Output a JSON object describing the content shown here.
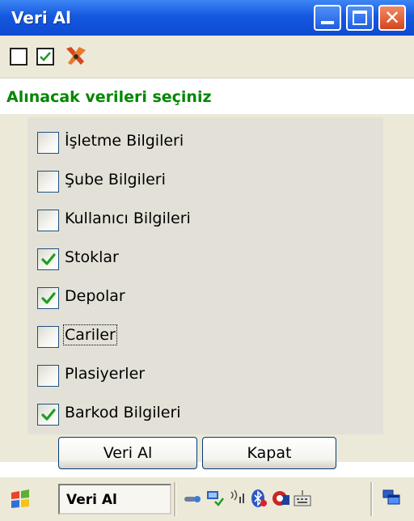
{
  "window": {
    "title": "Veri Al"
  },
  "header": {
    "label": "Alınacak verileri seçiniz"
  },
  "items": [
    {
      "label": "İşletme Bilgileri",
      "checked": false
    },
    {
      "label": "Şube Bilgileri",
      "checked": false
    },
    {
      "label": "Kullanıcı Bilgileri",
      "checked": false
    },
    {
      "label": "Stoklar",
      "checked": true
    },
    {
      "label": "Depolar",
      "checked": true
    },
    {
      "label": "Cariler",
      "checked": false
    },
    {
      "label": "Plasiyerler",
      "checked": false
    },
    {
      "label": "Barkod Bilgileri",
      "checked": true
    }
  ],
  "buttons": {
    "veri_al": "Veri Al",
    "kapat": "Kapat"
  },
  "taskbar": {
    "task_label": "Veri Al"
  },
  "colors": {
    "titlebar": "#0d4ad0",
    "header_text": "#008800",
    "check": "#1f9e1f"
  },
  "icons": [
    "select-none-icon",
    "select-all-icon",
    "tools-icon",
    "start-flag-icon",
    "tray-network-icon",
    "tray-computer-icon",
    "tray-signal-icon",
    "tray-bluetooth-icon",
    "tray-app-icon",
    "tray-keyboard-icon",
    "tray-windows-icon"
  ]
}
